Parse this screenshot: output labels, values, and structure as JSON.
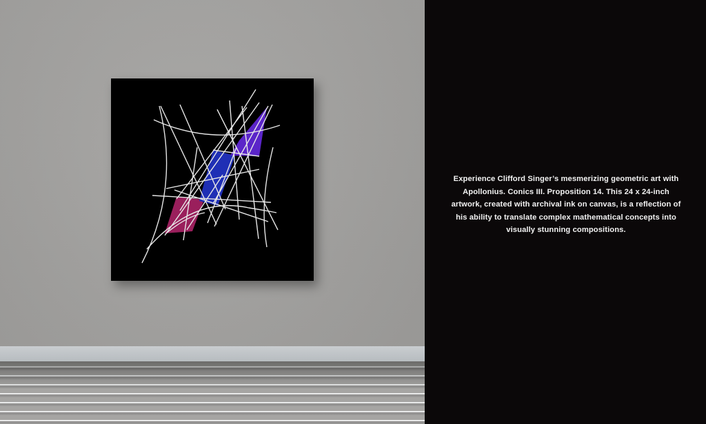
{
  "artwork": {
    "colors": {
      "background": "#000000",
      "line": "#e6e6e6",
      "blue_shape": "#1f2fb5",
      "purple_shape": "#5b25c9",
      "magenta_shape": "#9a1f5c"
    }
  },
  "caption": {
    "text": "Experience Clifford Singer’s mesmerizing geometric art with Apollonius. Conics III. Proposition 14. This 24 x 24-inch artwork, created with archival ink on canvas, is a reflection of his ability to translate complex mathematical concepts into visually stunning compositions."
  }
}
